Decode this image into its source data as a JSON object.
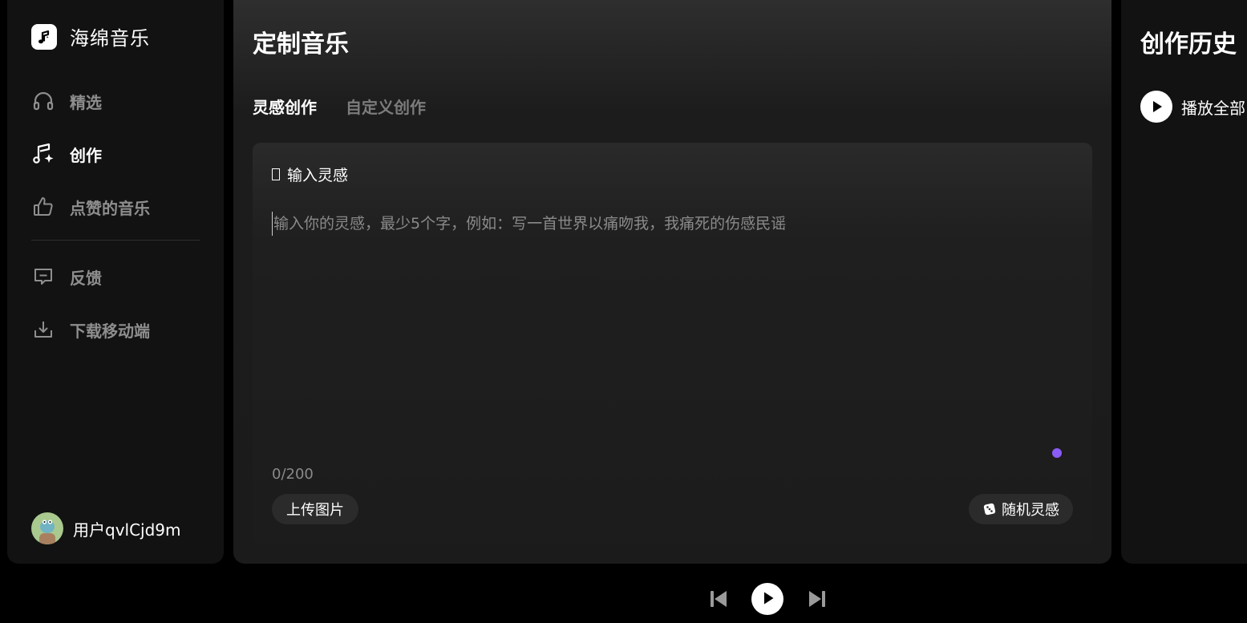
{
  "app": {
    "name": "海绵音乐",
    "logo_icon": "music-note-icon"
  },
  "sidebar": {
    "items": [
      {
        "label": "精选",
        "icon": "headphones-icon",
        "active": false
      },
      {
        "label": "创作",
        "icon": "music-sparkle-icon",
        "active": true
      },
      {
        "label": "点赞的音乐",
        "icon": "thumbs-up-icon",
        "active": false
      },
      {
        "label": "反馈",
        "icon": "feedback-icon",
        "active": false
      },
      {
        "label": "下载移动端",
        "icon": "download-icon",
        "active": false
      }
    ],
    "user": {
      "name": "用户qvlCjd9m",
      "icon": "avatar-icon"
    }
  },
  "main": {
    "title": "定制音乐",
    "tabs": [
      {
        "label": "灵感创作",
        "active": true
      },
      {
        "label": "自定义创作",
        "active": false
      }
    ],
    "card": {
      "label": "输入灵感",
      "placeholder": "输入你的灵感，最少5个字，例如：写一首世界以痛吻我，我痛死的伤感民谣",
      "value": "",
      "counter": "0/200",
      "upload_label": "上传图片",
      "random_label": "随机灵感",
      "random_icon": "dice-icon"
    }
  },
  "history": {
    "title": "创作历史",
    "play_all_label": "播放全部"
  },
  "player": {
    "prev_icon": "skip-previous-icon",
    "play_icon": "play-icon",
    "next_icon": "skip-next-icon"
  },
  "colors": {
    "background": "#000000",
    "panel": "#121212",
    "accent_dot": "#8a5cf5",
    "muted_text": "#8e8e8e"
  }
}
